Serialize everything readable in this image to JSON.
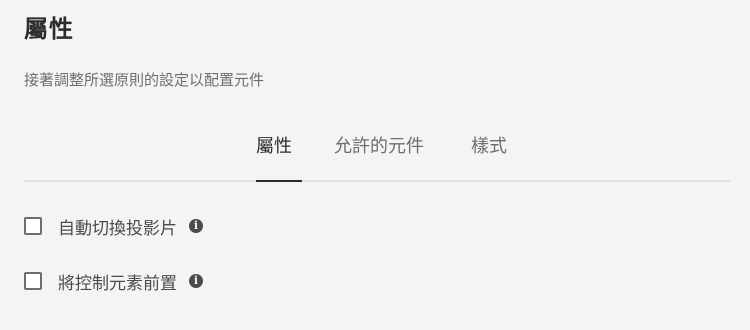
{
  "header": {
    "title": "屬性",
    "subtitle": "接著調整所選原則的設定以配置元件"
  },
  "tabs": [
    {
      "label": "屬性",
      "active": true
    },
    {
      "label": "允許的元件",
      "active": false
    },
    {
      "label": "樣式",
      "active": false
    }
  ],
  "options": [
    {
      "label": "自動切換投影片",
      "checked": false,
      "info_icon": "i"
    },
    {
      "label": "將控制元素前置",
      "checked": false,
      "info_icon": "i"
    }
  ],
  "colors": {
    "background": "#f4f4f4",
    "text_primary": "#2c2c2c",
    "text_secondary": "#6e6e6e",
    "divider": "#e1e1e1"
  }
}
